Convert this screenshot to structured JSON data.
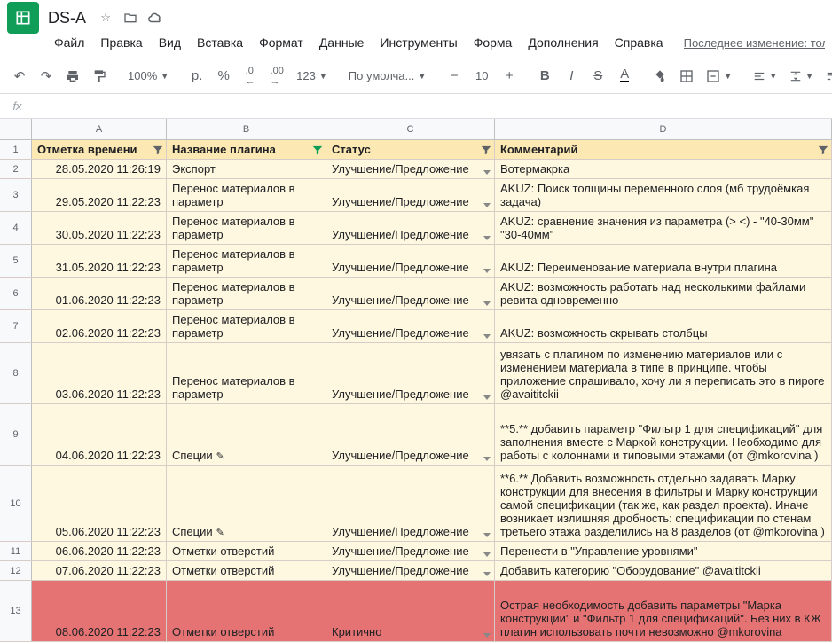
{
  "doc": {
    "title": "DS-A"
  },
  "menus": [
    "Файл",
    "Правка",
    "Вид",
    "Вставка",
    "Формат",
    "Данные",
    "Инструменты",
    "Форма",
    "Дополнения",
    "Справка"
  ],
  "last_edit": "Последнее изменение: тол",
  "toolbar": {
    "zoom": "100%",
    "currency": "р.",
    "percent": "%",
    "dec_dec": ".0",
    "dec_inc": ".00",
    "num_fmt": "123",
    "font": "По умолча...",
    "font_size": "10",
    "bold": "B",
    "italic": "I",
    "strike": "S",
    "text_color": "A"
  },
  "columns": [
    "A",
    "B",
    "C",
    "D"
  ],
  "headers": {
    "a": "Отметка времени",
    "b": "Название плагина",
    "c": "Статус",
    "d": "Комментарий"
  },
  "rows": [
    {
      "n": "2",
      "a": "28.05.2020 11:26:19",
      "b": "Экспорт",
      "c": "Улучшение/Предложение",
      "d": "Вотермакрка",
      "h": "single"
    },
    {
      "n": "3",
      "a": "29.05.2020 11:22:23",
      "b": "Перенос материалов в параметр",
      "c": "Улучшение/Предложение",
      "d": "AKUZ: Поиск толщины переменного слоя (мб трудоёмкая задача)",
      "h": "tall-2"
    },
    {
      "n": "4",
      "a": "30.05.2020 11:22:23",
      "b": "Перенос материалов в параметр",
      "c": "Улучшение/Предложение",
      "d": "AKUZ: сравнение значения из параметра (> <) - \"40-30мм\" \"30-40мм\"",
      "h": "tall-2"
    },
    {
      "n": "5",
      "a": "31.05.2020 11:22:23",
      "b": "Перенос материалов в параметр",
      "c": "Улучшение/Предложение",
      "d": "AKUZ: Переименование материала внутри плагина",
      "h": "tall-2"
    },
    {
      "n": "6",
      "a": "01.06.2020 11:22:23",
      "b": "Перенос материалов в параметр",
      "c": "Улучшение/Предложение",
      "d": "AKUZ: возможность работать над несколькими файлами ревита одновременно",
      "h": "tall-2"
    },
    {
      "n": "7",
      "a": "02.06.2020 11:22:23",
      "b": "Перенос материалов в параметр",
      "c": "Улучшение/Предложение",
      "d": "AKUZ: возможность скрывать столбцы",
      "h": "tall-2"
    },
    {
      "n": "8",
      "a": "03.06.2020 11:22:23",
      "b": "Перенос материалов в параметр",
      "c": "Улучшение/Предложение",
      "d": "увязать с плагином по изменению материалов или с изменением материала в типе в принципе. чтобы приложение спрашивало, хочу ли я переписать это в пироге @avaititckii",
      "h": "tall-4"
    },
    {
      "n": "9",
      "a": "04.06.2020 11:22:23",
      "b": "Специи",
      "c": "Улучшение/Предложение",
      "d": "**5.** добавить параметр \"Фильтр 1 для спецификаций\" для заполнения вместе с Маркой конструкции. Необходимо для работы с колоннами и типовыми этажами (от @mkorovina )",
      "h": "tall-4",
      "pencil": true
    },
    {
      "n": "10",
      "a": "05.06.2020 11:22:23",
      "b": "Специи",
      "c": "Улучшение/Предложение",
      "d": "**6.** Добавить возможность отдельно задавать Марку конструкции для внесения в фильтры и Марку конструкции самой спецификации (так же, как раздел проекта). Иначе возникает излишняя дробность: спецификации по стенам третьего этажа разделились на 8 разделов (от @mkorovina )",
      "h": "tall-5",
      "pencil": true
    },
    {
      "n": "11",
      "a": "06.06.2020 11:22:23",
      "b": "Отметки отверстий",
      "c": "Улучшение/Предложение",
      "d": "Перенести в \"Управление уровнями\"",
      "h": "single"
    },
    {
      "n": "12",
      "a": "07.06.2020 11:22:23",
      "b": "Отметки отверстий",
      "c": "Улучшение/Предложение",
      "d": "Добавить категорию \"Оборудование\" @avaititckii",
      "h": "single"
    },
    {
      "n": "13",
      "a": "08.06.2020 11:22:23",
      "b": "Отметки отверстий",
      "c": "Критично",
      "d": "Острая необходимость добавить параметры \"Марка конструкции\" и \"Фильтр 1 для спецификаций\".  Без них в КЖ плагин использовать почти невозможно @mkorovina",
      "h": "tall-4",
      "critical": true
    }
  ]
}
